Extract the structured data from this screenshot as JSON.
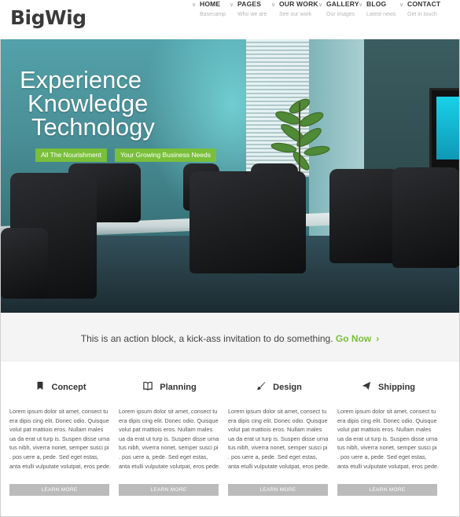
{
  "header": {
    "logo": "BigWig",
    "nav": [
      {
        "label": "HOME",
        "sub": "Basecamp"
      },
      {
        "label": "PAGES",
        "sub": "Who we are"
      },
      {
        "label": "OUR WORK",
        "sub": "See our work"
      },
      {
        "label": "GALLERY",
        "sub": "Our images"
      },
      {
        "label": "BLOG",
        "sub": "Latest news"
      },
      {
        "label": "CONTACT",
        "sub": "Get in touch"
      }
    ]
  },
  "hero": {
    "title_lines": [
      "Experience",
      "Knowledge",
      "Technology"
    ],
    "buttons": [
      "All The Nourishment",
      "Your Growing Business Needs"
    ]
  },
  "action": {
    "text": "This is an action block, a kick-ass invitation to do something.",
    "link": "Go Now",
    "chevron": "›"
  },
  "features": [
    {
      "icon": "bookmark-icon",
      "title": "Concept",
      "text": "Lorem ipsum dolor sit amet, consect tu era dipis cing elit. Donec odio. Quisque volut pat mattiois eros. Nullam males ua da erat ut turp is. Suspen disse urna tus nibh, viverra nonet, semper susci pi . pos uere a, pede. Sed eget estas, anta etulli vulputate volutpat, eros pede.",
      "button": "LEARN MORE"
    },
    {
      "icon": "book-icon",
      "title": "Planning",
      "text": "Lorem ipsum dolor sit amet, consect tu era dipis cing elit. Donec odio. Quisque volut pat mattiois eros. Nullam males ua da erat ut turp is. Suspen disse urna tus nibh, viverra nonet, semper susci pi . pos uere a, pede. Sed eget estas, anta etulli vulputate volutpat, eros pede.",
      "button": "LEARN MORE"
    },
    {
      "icon": "brush-icon",
      "title": "Design",
      "text": "Lorem ipsum dolor sit amet, consect tu era dipis cing elit. Donec odio. Quisque volut pat mattiois eros. Nullam males ua da erat ut turp is. Suspen disse urna tus nibh, viverra nonet, semper susci pi . pos uere a, pede. Sed eget estas, anta etulli vulputate volutpat, eros pede.",
      "button": "LEARN MORE"
    },
    {
      "icon": "paper-plane-icon",
      "title": "Shipping",
      "text": "Lorem ipsum dolor sit amet, consect tu era dipis cing elit. Donec odio. Quisque volut pat mattiois eros. Nullam males ua da erat ut turp is. Suspen disse urna tus nibh, viverra nonet, semper susci pi . pos uere a, pede. Sed eget estas, anta etulli vulputate volutpat, eros pede.",
      "button": "LEARN MORE"
    }
  ],
  "colors": {
    "accent": "#7abf3a",
    "button_gray": "#bbbbbb",
    "action_bg": "#f4f4f4"
  }
}
